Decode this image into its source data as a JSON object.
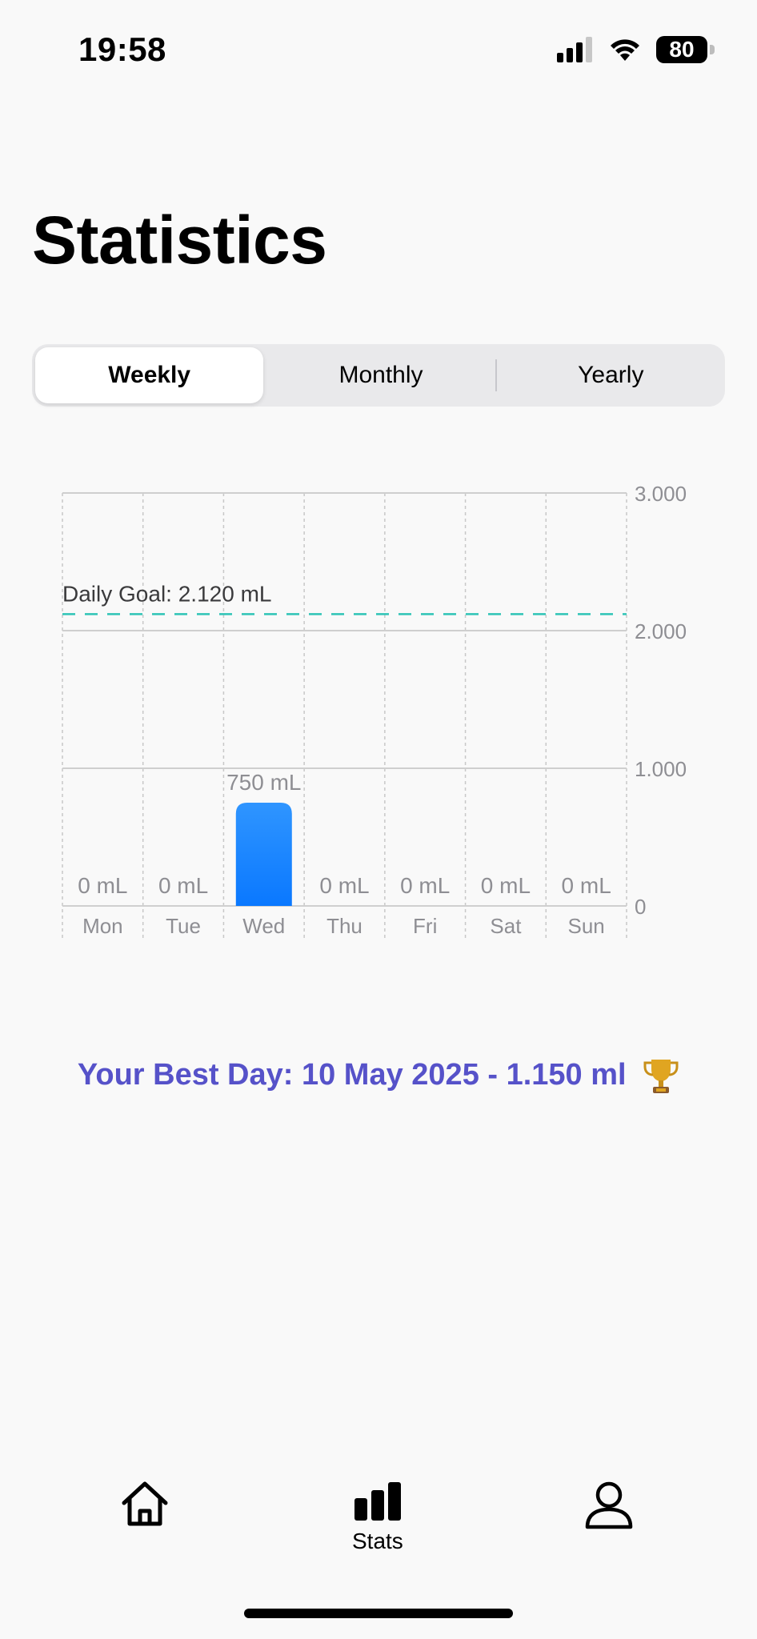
{
  "status_bar": {
    "time": "19:58",
    "battery_level": "80"
  },
  "page": {
    "title": "Statistics"
  },
  "segmented_control": {
    "segments": [
      {
        "label": "Weekly",
        "selected": true
      },
      {
        "label": "Monthly",
        "selected": false
      },
      {
        "label": "Yearly",
        "selected": false
      }
    ]
  },
  "chart_data": {
    "type": "bar",
    "categories": [
      "Mon",
      "Tue",
      "Wed",
      "Thu",
      "Fri",
      "Sat",
      "Sun"
    ],
    "values": [
      0,
      0,
      750,
      0,
      0,
      0,
      0
    ],
    "data_labels": [
      "0 mL",
      "0 mL",
      "750 mL",
      "0 mL",
      "0 mL",
      "0 mL",
      "0 mL"
    ],
    "ylim": [
      0,
      3000
    ],
    "y_ticks": [
      {
        "value": 0,
        "label": "0"
      },
      {
        "value": 1000,
        "label": "1.000"
      },
      {
        "value": 2000,
        "label": "2.000"
      },
      {
        "value": 3000,
        "label": "3.000"
      }
    ],
    "goal": {
      "value": 2120,
      "label": "Daily Goal: 2.120 mL",
      "color": "#2ec4b6"
    },
    "bar_color_top": "#2f95ff",
    "bar_color_bottom": "#0a78ff",
    "grid": true,
    "y_axis_side": "right"
  },
  "best_day": {
    "text": "Your Best Day: 10 May 2025 - 1.150 ml",
    "icon": "trophy-icon"
  },
  "tab_bar": {
    "items": [
      {
        "icon": "home-icon",
        "label": ""
      },
      {
        "icon": "stats-icon",
        "label": "Stats"
      },
      {
        "icon": "profile-icon",
        "label": ""
      }
    ]
  },
  "colors": {
    "accent_purple": "#5652c9",
    "goal_line": "#2ec4b6",
    "bar_blue": "#0a78ff"
  }
}
